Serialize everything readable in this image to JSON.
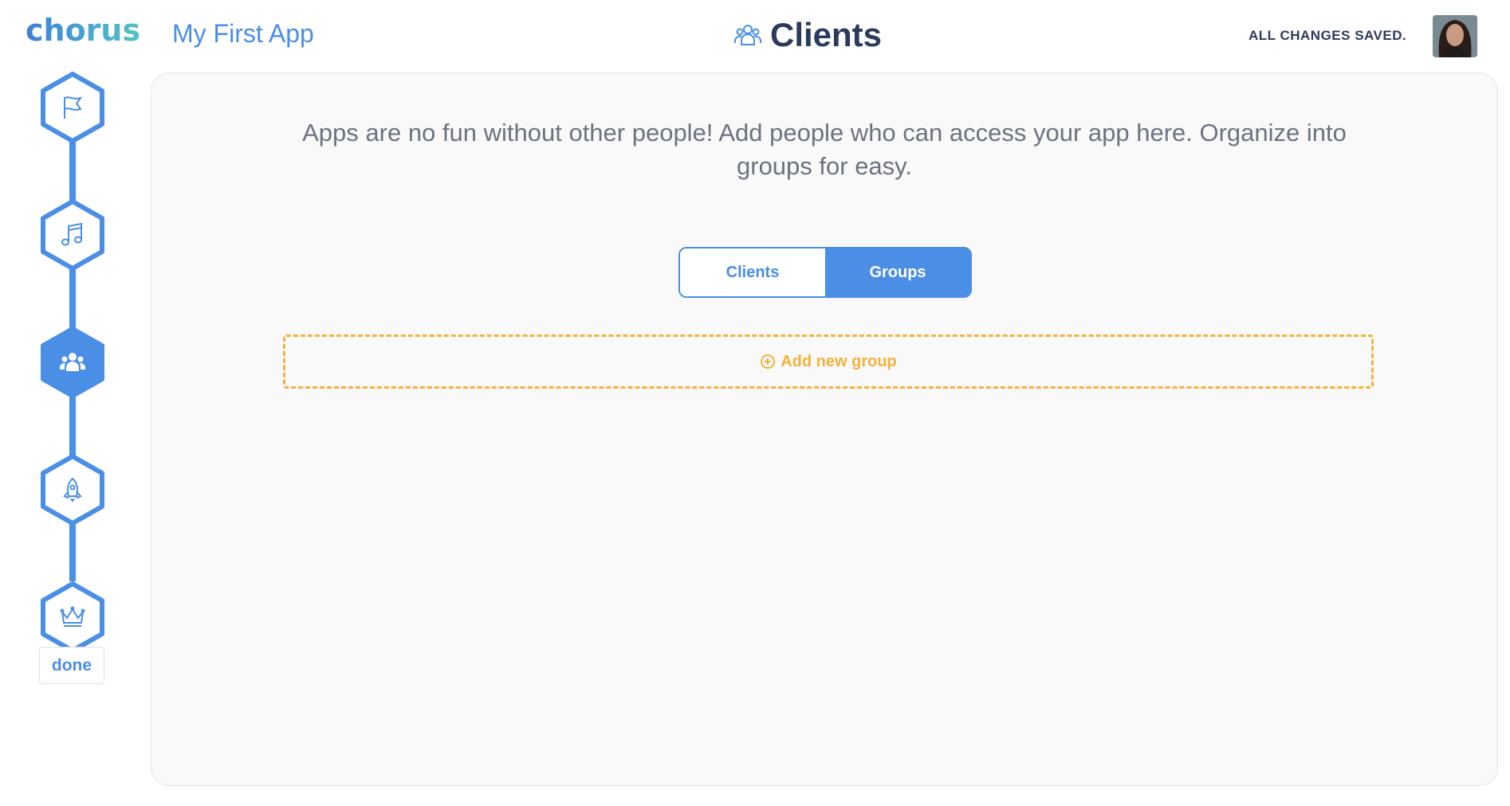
{
  "brand": {
    "logo_text": "chorus",
    "app_name": "My First App"
  },
  "header": {
    "title": "Clients",
    "title_icon": "users-outline-icon",
    "save_status": "ALL CHANGES SAVED."
  },
  "user": {
    "avatar": "user-avatar"
  },
  "stepper": {
    "steps": [
      {
        "name": "flag-icon",
        "state": "outline"
      },
      {
        "name": "music-note-icon",
        "state": "outline"
      },
      {
        "name": "users-icon",
        "state": "active"
      },
      {
        "name": "rocket-icon",
        "state": "outline"
      },
      {
        "name": "crown-icon",
        "state": "outline"
      }
    ],
    "done_label": "done"
  },
  "main": {
    "intro_line1": "Apps are no fun without other people! Add people who can access your app here. Organize into",
    "intro_line2": "groups for easy.",
    "toggle": {
      "clients_label": "Clients",
      "groups_label": "Groups",
      "selected": "Groups"
    },
    "add_group_label": "Add new group"
  },
  "colors": {
    "accent": "#4a8ee6",
    "warning": "#f3b23a",
    "title": "#2c3a5c",
    "panel_bg": "#f9f9f9"
  }
}
